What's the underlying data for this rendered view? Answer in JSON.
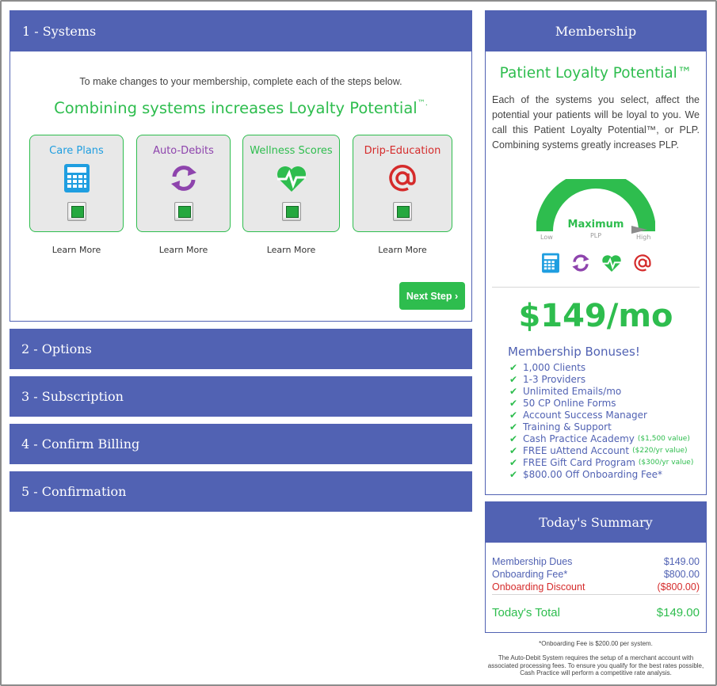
{
  "steps": {
    "systems": "1 - Systems",
    "options": "2 - Options",
    "subscription": "3 - Subscription",
    "billing": "4 - Confirm Billing",
    "confirmation": "5 - Confirmation"
  },
  "systems": {
    "intro": "To make changes to your membership, complete each of the steps below.",
    "loyalty_heading": "Combining systems increases Loyalty Potential",
    "tm": "™.",
    "learn_more": "Learn More",
    "next_step": "Next Step ›",
    "cards": [
      {
        "title": "Care Plans",
        "color": "#1f9ee0",
        "icon": "calculator-icon"
      },
      {
        "title": "Auto-Debits",
        "color": "#8e44ad",
        "icon": "sync-icon"
      },
      {
        "title": "Wellness Scores",
        "color": "#2ebd4e",
        "icon": "heartbeat-icon"
      },
      {
        "title": "Drip-Education",
        "color": "#d52b2b",
        "icon": "at-icon"
      }
    ]
  },
  "membership": {
    "header": "Membership",
    "plp_title": "Patient Loyalty Potential™",
    "plp_desc": "Each of the systems you select, affect the potential your patients will be loyal to you.  We call this Patient Loyalty Potential™, or PLP.  Combining systems greatly increases PLP.",
    "gauge": {
      "value_label": "Maximum",
      "sub_label": "PLP",
      "low": "Low",
      "high": "High",
      "level": 1.0
    },
    "price": "$149/mo",
    "bonus_title": "Membership Bonuses!",
    "bonuses": [
      {
        "text": "1,000 Clients",
        "note": ""
      },
      {
        "text": "1-3 Providers",
        "note": ""
      },
      {
        "text": "Unlimited Emails/mo",
        "note": ""
      },
      {
        "text": "50 CP Online Forms",
        "note": ""
      },
      {
        "text": "Account Success Manager",
        "note": ""
      },
      {
        "text": "Training & Support",
        "note": ""
      },
      {
        "text": "Cash Practice Academy",
        "note": "($1,500 value)"
      },
      {
        "text": "FREE uAttend Account",
        "note": "($220/yr value)"
      },
      {
        "text": "FREE Gift Card Program",
        "note": "($300/yr value)"
      },
      {
        "text": "$800.00 Off Onboarding Fee*",
        "note": ""
      }
    ]
  },
  "summary": {
    "header": "Today's Summary",
    "dues_label": "Membership Dues",
    "dues_value": "$149.00",
    "fee_label": "Onboarding Fee*",
    "fee_value": "$800.00",
    "discount_label": "Onboarding Discount",
    "discount_value": "($800.00)",
    "total_label": "Today's Total",
    "total_value": "$149.00"
  },
  "footnotes": {
    "fee_note": "*Onboarding Fee is $200.00 per system.",
    "autodebit_note": "The Auto-Debit System requires the setup of a merchant account with associated processing fees. To ensure you qualify for the best rates possible, Cash Practice will perform a competitive rate analysis."
  },
  "colors": {
    "brand": "#5162b3",
    "green": "#2ebd4e",
    "red": "#d52b2b"
  }
}
